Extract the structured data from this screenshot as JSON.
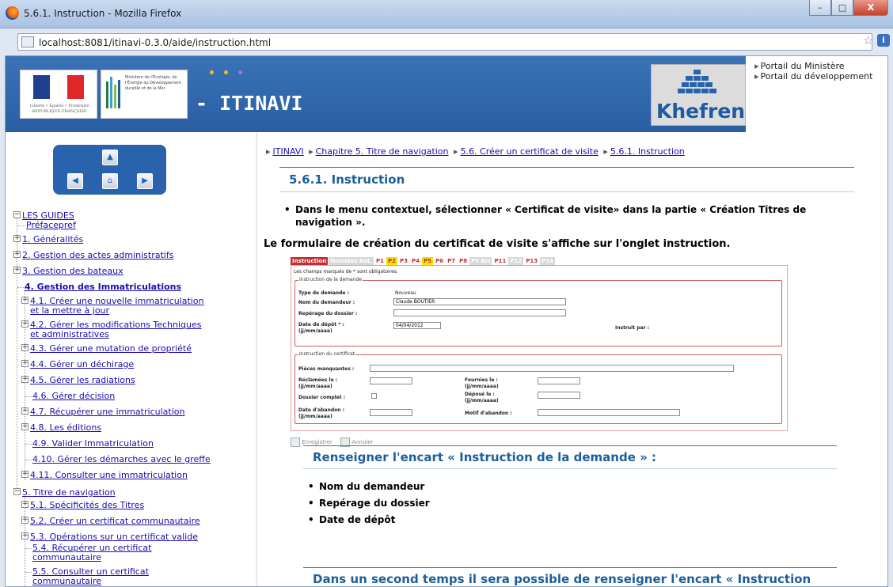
{
  "window": {
    "title": "5.6.1. Instruction - Mozilla Firefox",
    "minimize": "–",
    "maximize": "□",
    "close": "X"
  },
  "browser": {
    "url": "localhost:8081/itinavi-0.3.0/aide/instruction.html"
  },
  "banner": {
    "app_title": "- ITINAVI",
    "republique_caption": "Liberté • Égalité • Fraternité RÉPUBLIQUE FRANÇAISE",
    "ministere_caption": "Ministère de l'Écologie, de l'Énergie du Développement durable et de la Mer",
    "khefren": "Khefren",
    "links": [
      "Portail du Ministère",
      "Portail du développement"
    ],
    "dot_colors": [
      "#f2c200",
      "#f2c200",
      "#b56bd6"
    ]
  },
  "sidebar": {
    "tree": [
      {
        "label": "LES GUIDES",
        "bold": false
      },
      {
        "label": "Préfacepref",
        "bold": false
      },
      {
        "label": "1. Généralités",
        "bold": false
      },
      {
        "label": "2. Gestion des actes administratifs",
        "bold": false
      },
      {
        "label": "3. Gestion des bateaux",
        "bold": false
      },
      {
        "label": "4. Gestion des Immatriculations",
        "bold": true
      },
      {
        "label": "4.1. Créer une nouvelle immatriculation",
        "label2": "et la mettre à jour"
      },
      {
        "label": "4.2. Gérer les modifications Techniques",
        "label2": "et administratives"
      },
      {
        "label": "4.3. Gérer une mutation de propriété"
      },
      {
        "label": "4.4. Gérer un déchirage"
      },
      {
        "label": "4.5. Gérer les radiations"
      },
      {
        "label": "4.6. Gérer décision"
      },
      {
        "label": "4.7. Récupérer une immatriculation"
      },
      {
        "label": "4.8. Les éditions"
      },
      {
        "label": "4.9. Valider Immatriculation"
      },
      {
        "label": "4.10. Gérer les démarches avec le greffe"
      },
      {
        "label": "4.11. Consulter une immatriculation"
      },
      {
        "label": "5. Titre de navigation"
      },
      {
        "label": "5.1. Spécificités des Titres"
      },
      {
        "label": "5.2. Créer un certificat communautaire"
      },
      {
        "label": "5.3. Opérations sur un certificat valide"
      },
      {
        "label": "5.4. Récupérer un certificat",
        "label2": "communautaire"
      },
      {
        "label": "5.5. Consulter un certificat",
        "label2": "communautaire"
      }
    ]
  },
  "breadcrumb": [
    "ITINAVI",
    "Chapitre 5.  Titre de navigation",
    "5.6.  Créer un certificat de visite",
    "5.6.1.  Instruction"
  ],
  "main": {
    "section_title": "5.6.1. Instruction",
    "bullet1": "Dans le menu contextuel, sélectionner « Certificat de visite» dans la partie « Création Titres de navigation ».",
    "para1": "Le formulaire de création du certificat de visite s'affiche sur l'onglet instruction.",
    "subtitle1": "Renseigner l'encart « Instruction de la demande » :",
    "bullets2": [
      "Nom du demandeur",
      "Repérage du dossier",
      "Date de dépôt"
    ],
    "subtitle2": "Dans un second temps il sera possible de renseigner l'encart « Instruction"
  },
  "form_shot": {
    "tabs": [
      "Instruction",
      "Données Bat.",
      "P1",
      "P2",
      "P3",
      "P4",
      "P5",
      "P6",
      "P7",
      "P8",
      "P9 Bis",
      "P11",
      "P12",
      "P13",
      "P14"
    ],
    "required_note": "Les champs marqués de * sont obligatoires.",
    "fs1_legend": "Instruction de la demande",
    "type_label": "Type de demande :",
    "type_value": "Nouveau",
    "nom_label": "Nom du demandeur :",
    "nom_value": "Claude BOUTIER",
    "reperage_label": "Repérage du dossier :",
    "date_label": "Date de dépôt * :",
    "date_fmt": "(jj/mm/aaaa)",
    "date_value": "04/04/2012",
    "instruit_label": "Instruit par :",
    "fs2_legend": "Instruction du certificat",
    "pieces_label": "Pièces manquantes :",
    "reclamees_label": "Réclamées le :",
    "fournies_label": "Fournies le :",
    "dossier_label": "Dossier complet :",
    "depose_label": "Déposé le :",
    "abandon_label": "Date d'abandon :",
    "motif_label": "Motif d'abandon :",
    "save_label": "Enregistrer",
    "cancel_label": "Annuler"
  }
}
